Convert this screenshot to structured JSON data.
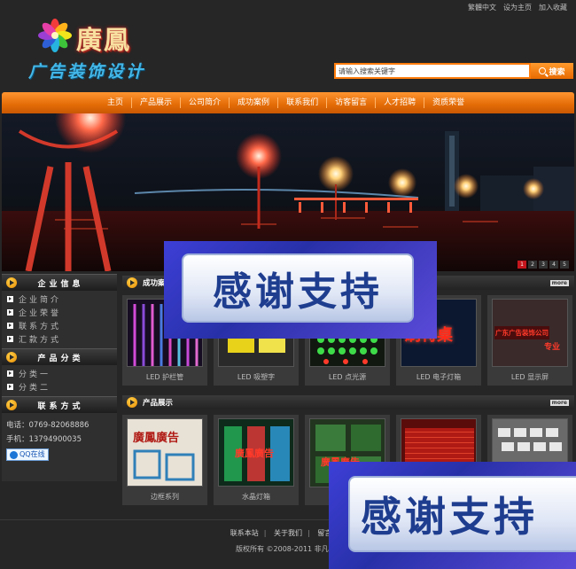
{
  "top_links": [
    "繁體中文",
    "设为主页",
    "加入收藏"
  ],
  "logo": {
    "name": "廣鳳",
    "subtitle": "广告装饰设计"
  },
  "search": {
    "placeholder": "请输入搜索关键字",
    "button_label": "搜索"
  },
  "nav": [
    "主页",
    "产品展示",
    "公司简介",
    "成功案例",
    "联系我们",
    "访客留言",
    "人才招聘",
    "资质荣誉"
  ],
  "banner": {
    "slides": [
      "1",
      "2",
      "3",
      "4",
      "5"
    ],
    "active_slide": 1
  },
  "sidebar": {
    "company_info": {
      "title": "企业信息",
      "items": [
        "企业简介",
        "企业荣誉",
        "联系方式",
        "汇款方式"
      ]
    },
    "product_categories": {
      "title": "产品分类",
      "items": [
        "分类一",
        "分类二"
      ]
    },
    "contact": {
      "title": "联系方式",
      "phone": "电话：0769-82068886",
      "mobile": "手机：13794900035",
      "qq_label": "QQ在线"
    }
  },
  "cases_section": {
    "title": "成功案",
    "more": "more",
    "items": [
      {
        "caption": "LED 护栏管",
        "color": "#b04ab8"
      },
      {
        "caption": "LED 吸塑字",
        "color": "#d7c21a"
      },
      {
        "caption": "LED 点光源",
        "color": "#2fbf3a"
      },
      {
        "caption": "LED 电子灯箱",
        "color": "#d11c16"
      },
      {
        "caption": "LED 显示屏",
        "color": "#c22418"
      }
    ],
    "photo_texts": {
      "card4": "刷特桌",
      "card5_line1": "广东广告装饰公司",
      "card5_line2": "专业"
    }
  },
  "products_section": {
    "title": "产品展示",
    "more": "more",
    "items": [
      {
        "caption": "边框系列",
        "color": "#2f7fb8",
        "photo_text": "廣鳳廣告"
      },
      {
        "caption": "水晶灯箱",
        "color": "#27b35a",
        "photo_text": "廣鳳廣告"
      },
      {
        "caption": "",
        "color": "#3a7a3a",
        "photo_text": "廣鳳廣告"
      },
      {
        "caption": "",
        "color": "#b01a14",
        "photo_text": ""
      },
      {
        "caption": "",
        "color": "#999999",
        "photo_text": ""
      }
    ]
  },
  "overlay_text": "感谢支持",
  "overlay_text_2": "感谢支持",
  "footer": {
    "links": [
      "联系本站",
      "关于我们",
      "留言反馈"
    ],
    "copyright": "版权所有 ©2008-2011 非凡"
  }
}
